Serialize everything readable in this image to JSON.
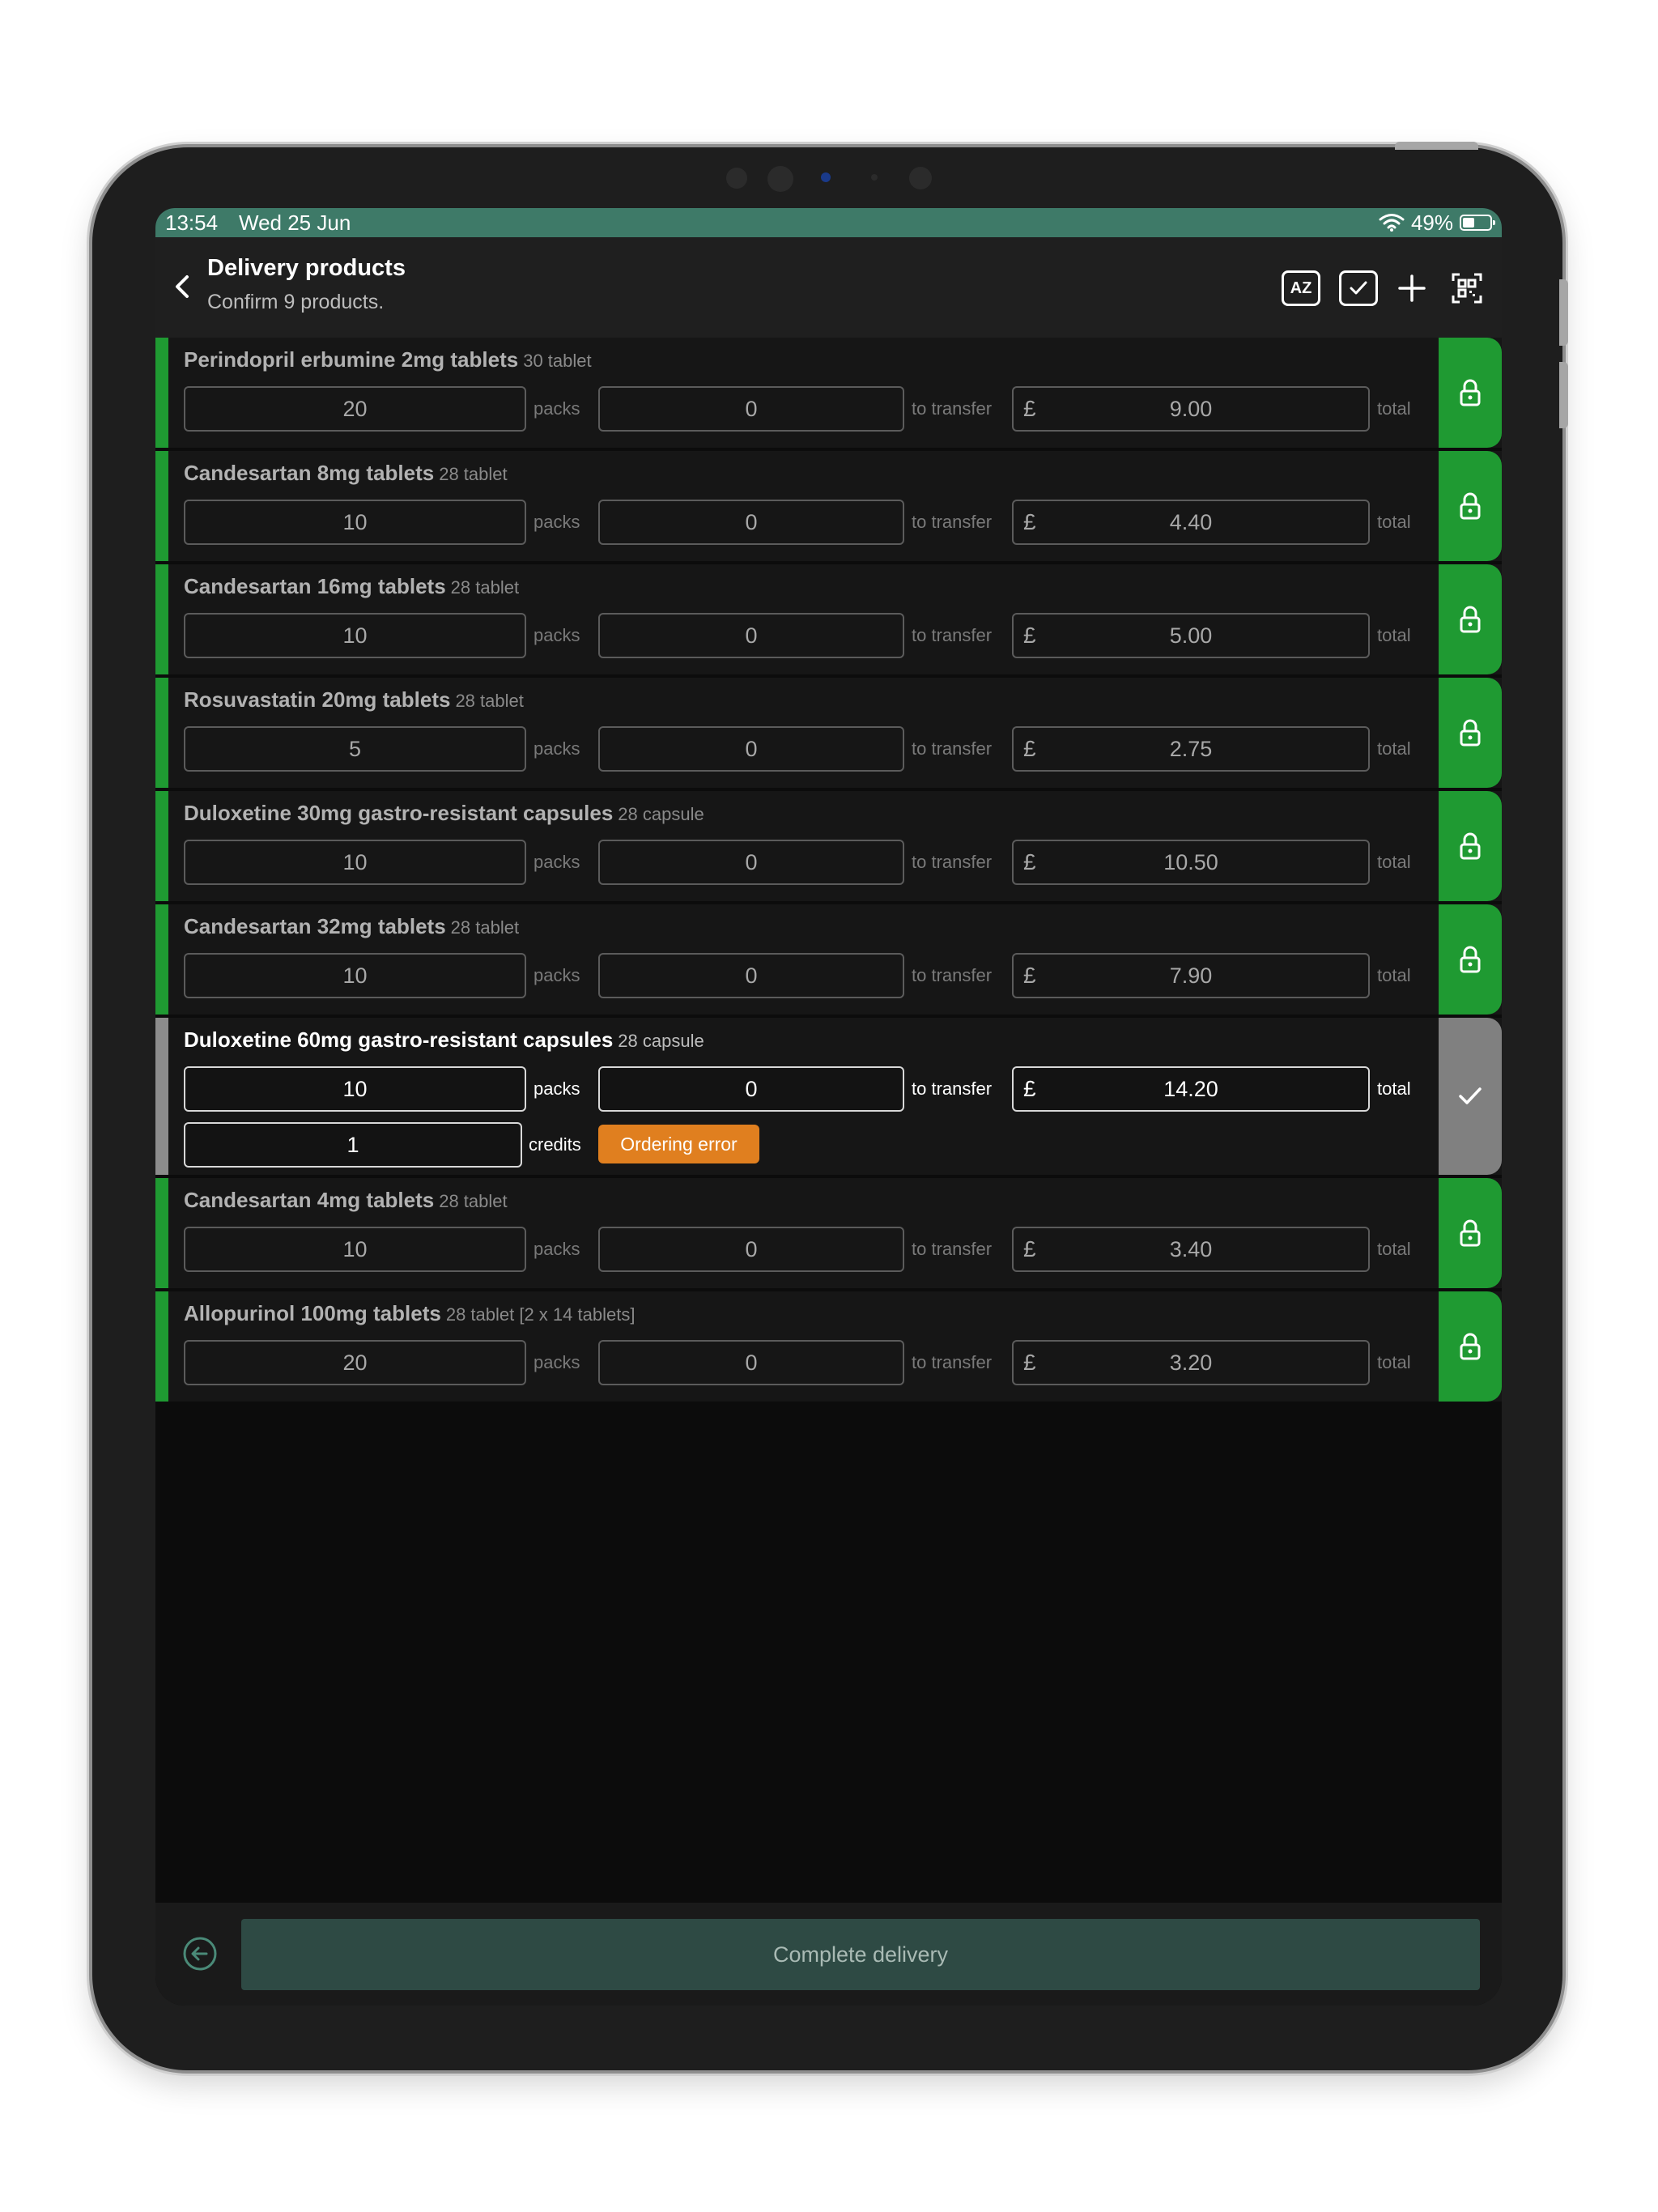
{
  "status": {
    "time": "13:54",
    "date": "Wed 25 Jun",
    "battery": "49%",
    "battery_level": 0.49
  },
  "header": {
    "title": "Delivery products",
    "subtitle": "Confirm 9 products.",
    "sort_label": "AZ"
  },
  "labels": {
    "packs": "packs",
    "to_transfer": "to transfer",
    "total": "total",
    "credits": "credits",
    "currency": "£"
  },
  "products": [
    {
      "name": "Perindopril erbumine 2mg tablets",
      "pack_size": "30 tablet",
      "packs": "20",
      "transfer": "0",
      "total": "9.00",
      "state": "locked"
    },
    {
      "name": "Candesartan 8mg tablets",
      "pack_size": "28 tablet",
      "packs": "10",
      "transfer": "0",
      "total": "4.40",
      "state": "locked"
    },
    {
      "name": "Candesartan 16mg tablets",
      "pack_size": "28 tablet",
      "packs": "10",
      "transfer": "0",
      "total": "5.00",
      "state": "locked"
    },
    {
      "name": "Rosuvastatin 20mg tablets",
      "pack_size": "28 tablet",
      "packs": "5",
      "transfer": "0",
      "total": "2.75",
      "state": "locked"
    },
    {
      "name": "Duloxetine 30mg gastro-resistant capsules",
      "pack_size": "28 capsule",
      "packs": "10",
      "transfer": "0",
      "total": "10.50",
      "state": "locked"
    },
    {
      "name": "Candesartan 32mg tablets",
      "pack_size": "28 tablet",
      "packs": "10",
      "transfer": "0",
      "total": "7.90",
      "state": "locked"
    },
    {
      "name": "Duloxetine 60mg gastro-resistant capsules",
      "pack_size": "28 capsule",
      "packs": "10",
      "transfer": "0",
      "total": "14.20",
      "state": "active",
      "credits": "1",
      "badge": "Ordering error"
    },
    {
      "name": "Candesartan 4mg tablets",
      "pack_size": "28 tablet",
      "packs": "10",
      "transfer": "0",
      "total": "3.40",
      "state": "locked"
    },
    {
      "name": "Allopurinol 100mg tablets",
      "pack_size": "28 tablet [2 x 14 tablets]",
      "packs": "20",
      "transfer": "0",
      "total": "3.20",
      "state": "locked"
    }
  ],
  "footer": {
    "complete_label": "Complete delivery"
  },
  "colors": {
    "status_bar": "#3e7a68",
    "locked": "#1f9a32",
    "active": "#8c8c8c",
    "badge": "#e07f1f",
    "complete_button": "#2e4a44"
  }
}
